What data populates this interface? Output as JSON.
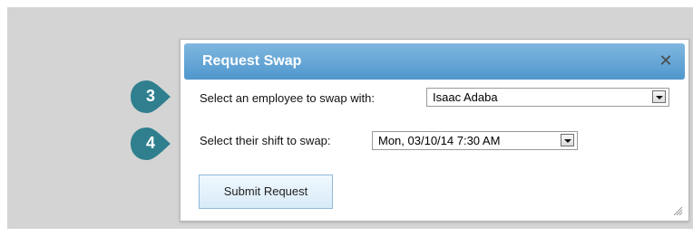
{
  "dialog": {
    "title": "Request Swap",
    "close_icon": "close-icon"
  },
  "form": {
    "employee_label": "Select an employee to swap with:",
    "employee_value": "Isaac Adaba",
    "shift_label": "Select their shift to swap:",
    "shift_value": "Mon, 03/10/14 7:30 AM",
    "submit_label": "Submit Request"
  },
  "markers": [
    {
      "label": "3"
    },
    {
      "label": "4"
    }
  ],
  "colors": {
    "titlebar_top": "#7fb7df",
    "titlebar_bottom": "#4f97cd",
    "marker": "#2f7f8f",
    "button_top": "#f0f8fe",
    "button_bottom": "#d8ebf8",
    "backdrop": "#d4d4d4"
  }
}
